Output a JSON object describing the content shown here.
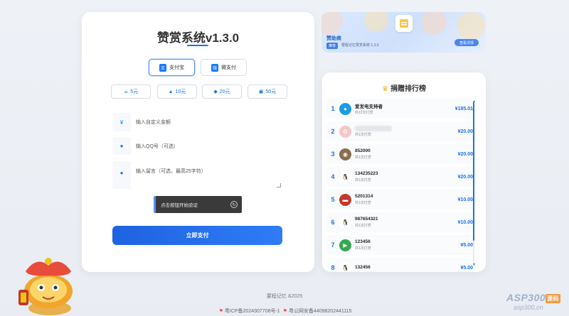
{
  "main": {
    "title": "赞赏系统v1.3.0",
    "pay_tabs": [
      {
        "label": "支付宝",
        "icon": "alipay-icon",
        "active": true
      },
      {
        "label": "微支付",
        "icon": "wechat-pay-icon",
        "active": false
      }
    ],
    "amounts": [
      {
        "label": "5元",
        "icon": "coffee-icon"
      },
      {
        "label": "10元",
        "icon": "cake-icon"
      },
      {
        "label": "20元",
        "icon": "pizza-icon"
      },
      {
        "label": "50元",
        "icon": "gift-icon"
      }
    ],
    "amount_field": {
      "prefix": "¥",
      "placeholder": "输入自定义金额"
    },
    "qq_field": {
      "placeholder": "输入QQ号（可选）",
      "icon": "qq-icon"
    },
    "message_field": {
      "placeholder": "输入留言（可选，最高25字符）",
      "icon": "chat-icon"
    },
    "captcha": {
      "label": "点击按钮开始验证",
      "icon": "refresh-icon"
    },
    "submit_label": "立即支付"
  },
  "sponsor": {
    "title": "赞助商",
    "badge": "推荐",
    "desc": "要程记忆赞赏系统 1.3.0",
    "button": "查看详情"
  },
  "ranking": {
    "title": "捐赠排行榜",
    "crown_icon": "crown-icon",
    "rows": [
      {
        "rank": "1",
        "name": "爱发电支持者",
        "sub": "共12次打赏",
        "amount": "¥185.01",
        "avatar": "qq-penguin-blue",
        "blur": false
      },
      {
        "rank": "2",
        "name": "",
        "sub": "共1次打赏",
        "amount": "¥20.00",
        "avatar": "anime-girl",
        "blur": true
      },
      {
        "rank": "3",
        "name": "852000",
        "sub": "共1次打赏",
        "amount": "¥20.00",
        "avatar": "photo",
        "blur": false
      },
      {
        "rank": "4",
        "name": "134235223",
        "sub": "共1次打赏",
        "amount": "¥20.00",
        "avatar": "qq-penguin",
        "blur": false
      },
      {
        "rank": "5",
        "name": "5201314",
        "sub": "共1次打赏",
        "amount": "¥10.00",
        "avatar": "red-car",
        "blur": false
      },
      {
        "rank": "6",
        "name": "987654321",
        "sub": "共1次打赏",
        "amount": "¥10.00",
        "avatar": "qq-penguin",
        "blur": false
      },
      {
        "rank": "7",
        "name": "123456",
        "sub": "共1次打赏",
        "amount": "¥5.00",
        "avatar": "play-store",
        "blur": false
      },
      {
        "rank": "8",
        "name": "132456",
        "sub": "",
        "amount": "¥5.00",
        "avatar": "qq-penguin",
        "blur": false
      }
    ]
  },
  "footer": {
    "copyright": "要程记忆 &2025",
    "icp": "粤ICP备2024307708号-1",
    "police": "粤公网安备44098202441115"
  },
  "watermark": {
    "brand": "ASP300",
    "tag": "源码",
    "url": "asp300.cn"
  },
  "colors": {
    "accent": "#1a73e8",
    "crown": "#f3b51b",
    "captcha_bg": "#3a3a3a"
  }
}
